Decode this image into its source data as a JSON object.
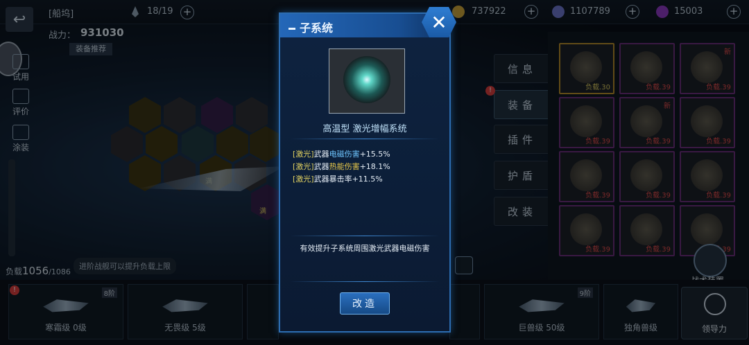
{
  "topbar": {
    "title": "[船坞]",
    "slots": "18/19",
    "resources": [
      {
        "name": "credits",
        "value": "737922",
        "color": "#c9a23a"
      },
      {
        "name": "crystals",
        "value": "1107789",
        "color": "#6a74c8"
      },
      {
        "name": "gems",
        "value": "15003",
        "color": "#8a3ac0"
      }
    ]
  },
  "left": {
    "power_label": "战力：",
    "power_value": "931030",
    "recommend": "装备推荐",
    "side": [
      "试用",
      "评价",
      "涂装"
    ],
    "load_label": "负载",
    "load_value": "1056",
    "load_max": "/1086",
    "hint": "进阶战舰可以提升负载上限",
    "hex_full": "满"
  },
  "tabs": [
    "信息",
    "装备",
    "插件",
    "护盾",
    "改装"
  ],
  "grid": [
    {
      "label": "负载.30"
    },
    {
      "label": "负载.39"
    },
    {
      "label": "负载.39",
      "badge": "新"
    },
    {
      "label": "负载.39"
    },
    {
      "label": "负载.39",
      "badge": "新"
    },
    {
      "label": "负载.39"
    },
    {
      "label": "负载.39"
    },
    {
      "label": "负载.39"
    },
    {
      "label": "负载.39"
    },
    {
      "label": "负载.39"
    },
    {
      "label": "负载.39"
    },
    {
      "label": "负载.39"
    }
  ],
  "tactical": "战术装置",
  "leadership": "领导力",
  "ships": [
    {
      "name": "寒霜级 0级",
      "tier": "8阶"
    },
    {
      "name": "无畏级 5级",
      "tier": ""
    },
    {
      "name": "",
      "tier": ""
    },
    {
      "name": "巨兽级 50级",
      "tier": "9阶"
    },
    {
      "name": "独角兽级",
      "tier": ""
    }
  ],
  "modal": {
    "title": "子系统",
    "close": "✕",
    "quality": "高温型",
    "item": "激光增幅系统",
    "stats": [
      {
        "tag": "[激光]",
        "pre": "武器",
        "hl": "电磁伤害",
        "val": "+15.5%"
      },
      {
        "tag": "[激光]",
        "pre": "武器",
        "hl": "热能伤害",
        "val": "+18.1%"
      },
      {
        "tag": "[激光]",
        "pre": "武器暴击率",
        "hl": "",
        "val": "+11.5%"
      }
    ],
    "description": "有效提升子系统周围激光武器电磁伤害",
    "button": "改造"
  }
}
